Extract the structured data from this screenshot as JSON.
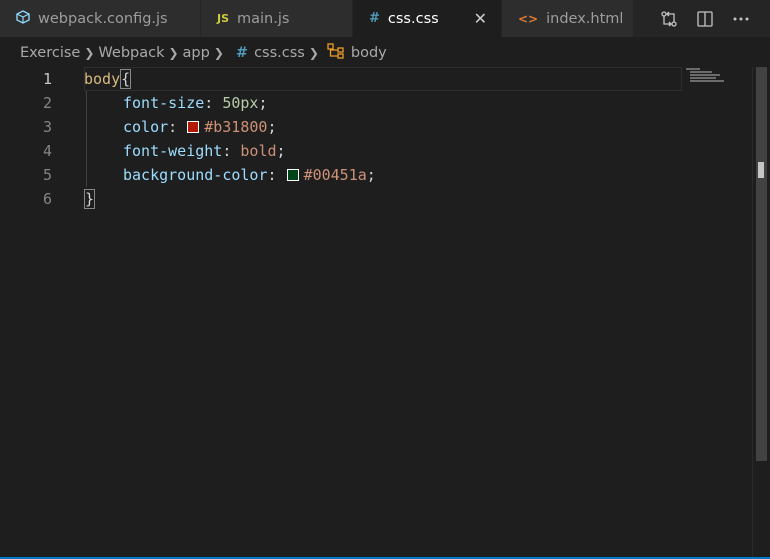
{
  "tabs": [
    {
      "label": "webpack.config.js",
      "icon": "cube-icon",
      "active": false
    },
    {
      "label": "main.js",
      "icon": "js-icon",
      "icon_text": "JS",
      "active": false
    },
    {
      "label": "css.css",
      "icon": "hash-icon",
      "icon_text": "#",
      "active": true,
      "close": "✕"
    },
    {
      "label": "index.html",
      "icon": "code-brackets-icon",
      "icon_text": "<>",
      "active": false
    }
  ],
  "breadcrumb": {
    "items": [
      "Exercise",
      "Webpack",
      "app",
      "css.css",
      "body"
    ],
    "hash": "#"
  },
  "editor": {
    "line_numbers": [
      "1",
      "2",
      "3",
      "4",
      "5",
      "6"
    ],
    "lines": {
      "l1": {
        "selector": "body",
        "brace": "{"
      },
      "l2": {
        "prop": "font-size",
        "colon": ": ",
        "value": "50px",
        "semi": ";"
      },
      "l3": {
        "prop": "color",
        "colon": ": ",
        "value": "#b31800",
        "semi": ";",
        "swatch": "#b31800"
      },
      "l4": {
        "prop": "font-weight",
        "colon": ": ",
        "value": "bold",
        "semi": ";"
      },
      "l5": {
        "prop": "background-color",
        "colon": ": ",
        "value": "#00451a",
        "semi": ";",
        "swatch": "#00451a"
      },
      "l6": {
        "brace": "}"
      }
    }
  },
  "colors": {
    "accent": "#007acc",
    "selector": "#d7ba7d",
    "property": "#9cdcfe",
    "number": "#b5cea8",
    "string_value": "#ce9178",
    "js_icon": "#cbcb41",
    "css_icon": "#519aba",
    "html_icon": "#e37933",
    "webpack_icon": "#8ed6fb"
  }
}
